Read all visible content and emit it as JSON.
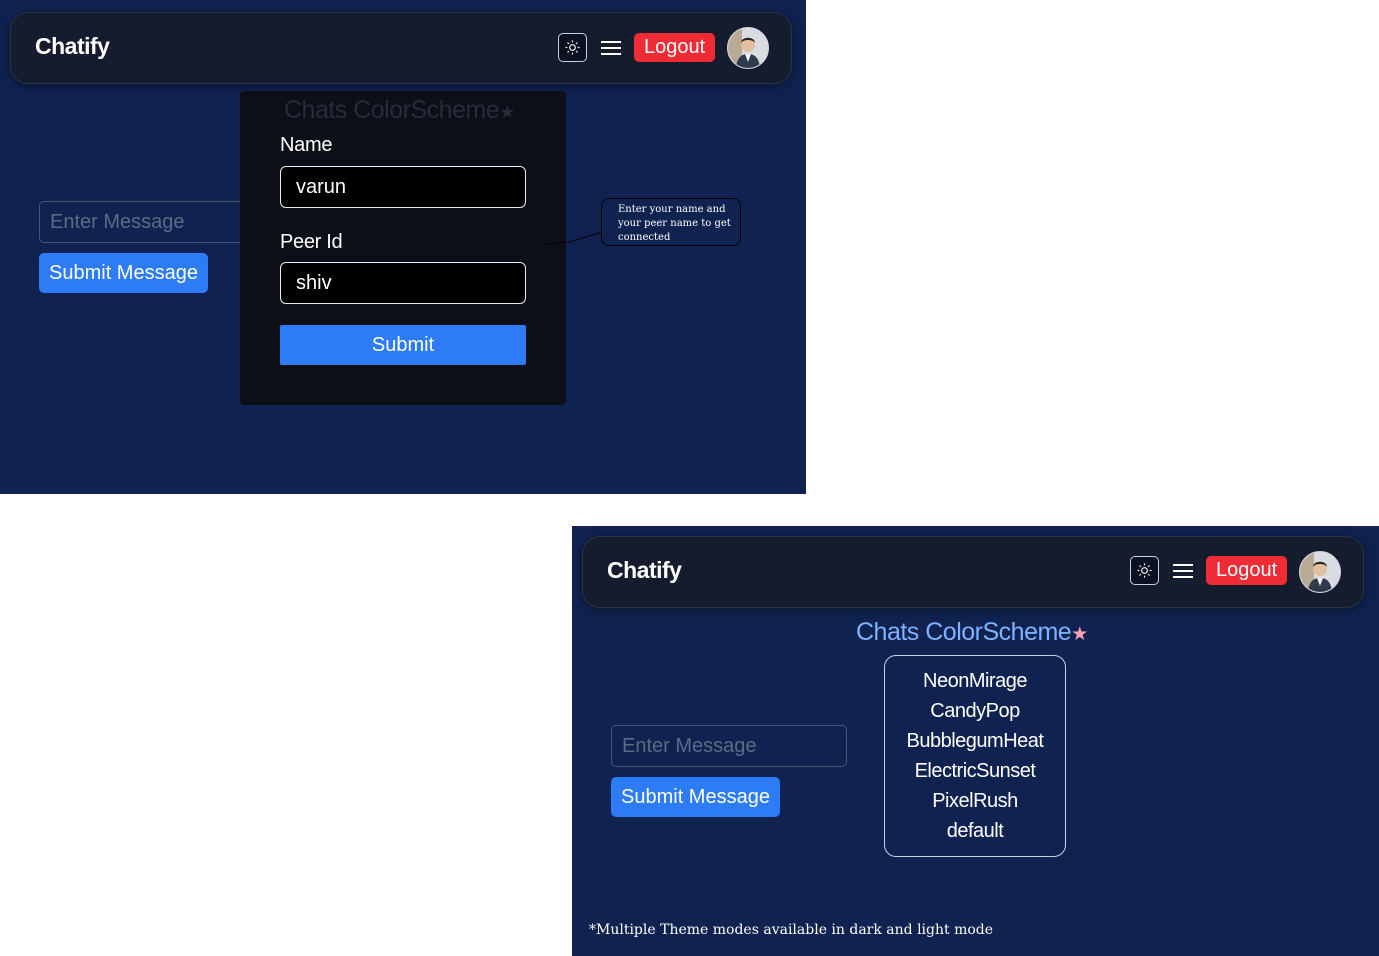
{
  "app": {
    "brand": "Chatify"
  },
  "header": {
    "theme_toggle_icon": "sun-icon",
    "menu_icon": "hamburger-menu-icon",
    "logout_label": "Logout",
    "avatar_icon": "user-avatar"
  },
  "colors": {
    "background": "#0f2250",
    "navbar": "#141c2e",
    "accent_blue": "#2d7cf6",
    "logout_red": "#ef2b36",
    "scheme_heading": "#7fb2ff",
    "star_pink": "#ff9fb8"
  },
  "chat": {
    "message_placeholder": "Enter Message",
    "submit_label": "Submit Message"
  },
  "modal": {
    "heading": "Chats ColorScheme",
    "star_icon": "star-icon",
    "name_label": "Name",
    "name_value": "varun",
    "peer_label": "Peer Id",
    "peer_value": "shiv",
    "submit_label": "Submit",
    "tooltip": "Enter your name and your peer name to get connected"
  },
  "colorscheme": {
    "heading": "Chats ColorScheme",
    "star_icon": "star-icon",
    "options": [
      "NeonMirage",
      "CandyPop",
      "BubblegumHeat",
      "ElectricSunset",
      "PixelRush",
      "default"
    ]
  },
  "footnote": "*Multiple Theme modes available in dark and light mode"
}
